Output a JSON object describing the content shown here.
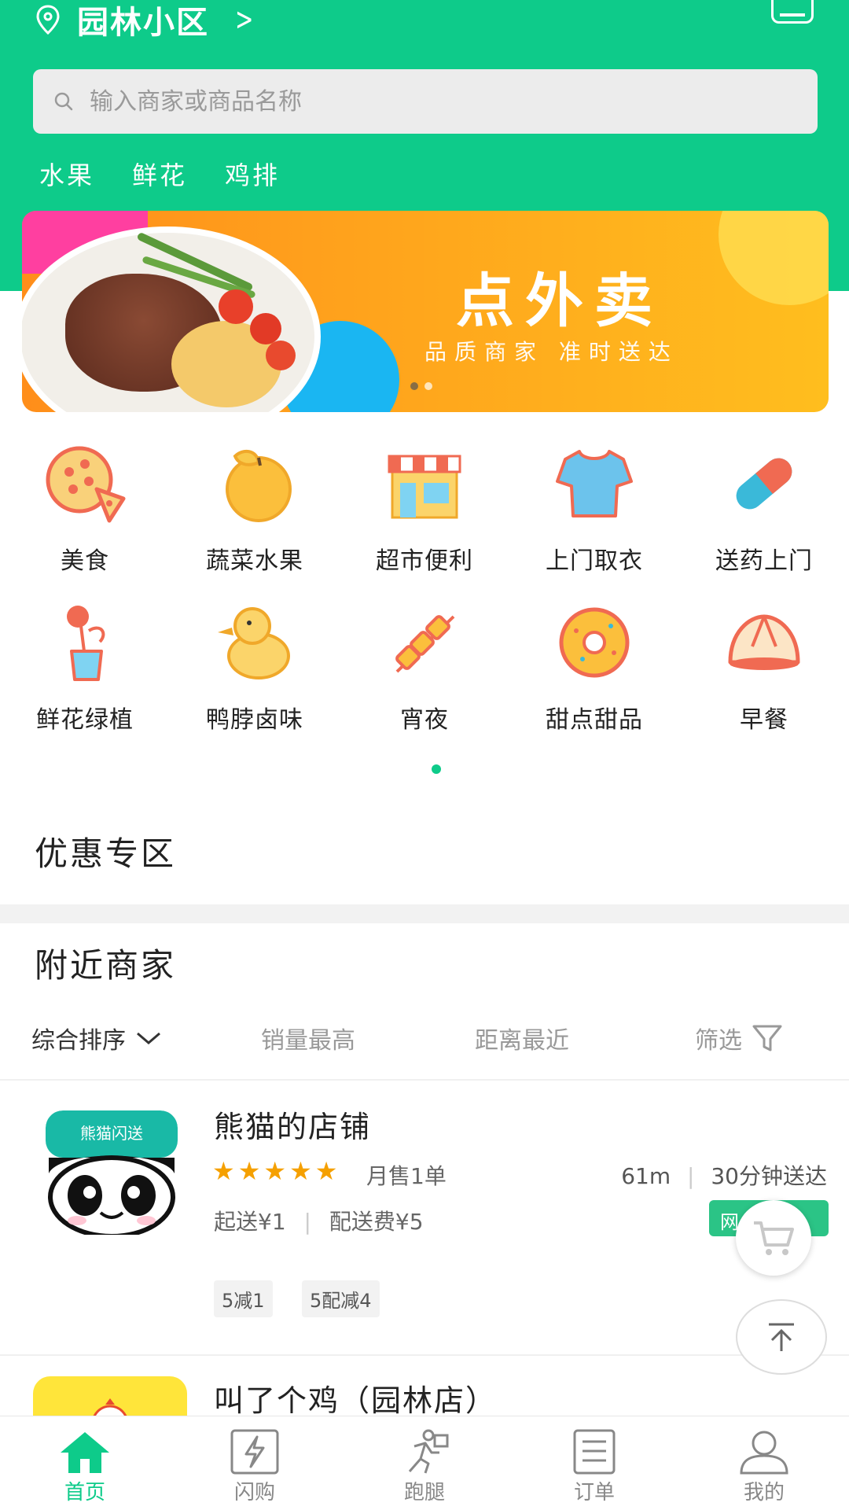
{
  "location": {
    "name": "园林小区"
  },
  "search": {
    "placeholder": "输入商家或商品名称"
  },
  "hot_keywords": [
    "水果",
    "鲜花",
    "鸡排"
  ],
  "banner": {
    "title": "点外卖",
    "subtitle": "品质商家 准时送达",
    "pages": 2,
    "active_page": 0
  },
  "categories": [
    {
      "label": "美食",
      "icon": "pizza-icon"
    },
    {
      "label": "蔬菜水果",
      "icon": "orange-icon"
    },
    {
      "label": "超市便利",
      "icon": "store-icon"
    },
    {
      "label": "上门取衣",
      "icon": "tshirt-icon"
    },
    {
      "label": "送药上门",
      "icon": "pill-icon"
    },
    {
      "label": "鲜花绿植",
      "icon": "flower-icon"
    },
    {
      "label": "鸭脖卤味",
      "icon": "duck-icon"
    },
    {
      "label": "宵夜",
      "icon": "skewer-icon"
    },
    {
      "label": "甜点甜品",
      "icon": "donut-icon"
    },
    {
      "label": "早餐",
      "icon": "bun-icon"
    }
  ],
  "sections": {
    "discount": "优惠专区",
    "nearby": "附近商家"
  },
  "sort": {
    "comprehensive": "综合排序",
    "sales": "销量最高",
    "distance": "距离最近",
    "filter": "筛选"
  },
  "shops": [
    {
      "name": "熊猫的店铺",
      "logo_text": "熊猫闪送",
      "rating": 5,
      "monthly_sales": "月售1单",
      "distance": "61m",
      "delivery_time": "30分钟送达",
      "min_order": "起送¥1",
      "delivery_fee": "配送费¥5",
      "badge": "网",
      "promos": [
        "5减1",
        "5配减4"
      ]
    },
    {
      "name": "叫了个鸡（园林店）"
    }
  ],
  "tabs": [
    {
      "label": "首页",
      "icon": "home-icon",
      "active": true
    },
    {
      "label": "闪购",
      "icon": "flash-icon",
      "active": false
    },
    {
      "label": "跑腿",
      "icon": "runner-icon",
      "active": false
    },
    {
      "label": "订单",
      "icon": "order-icon",
      "active": false
    },
    {
      "label": "我的",
      "icon": "user-icon",
      "active": false
    }
  ],
  "colors": {
    "brand": "#0ecb8a",
    "star": "#f5a000",
    "banner": "#ffa21c"
  }
}
